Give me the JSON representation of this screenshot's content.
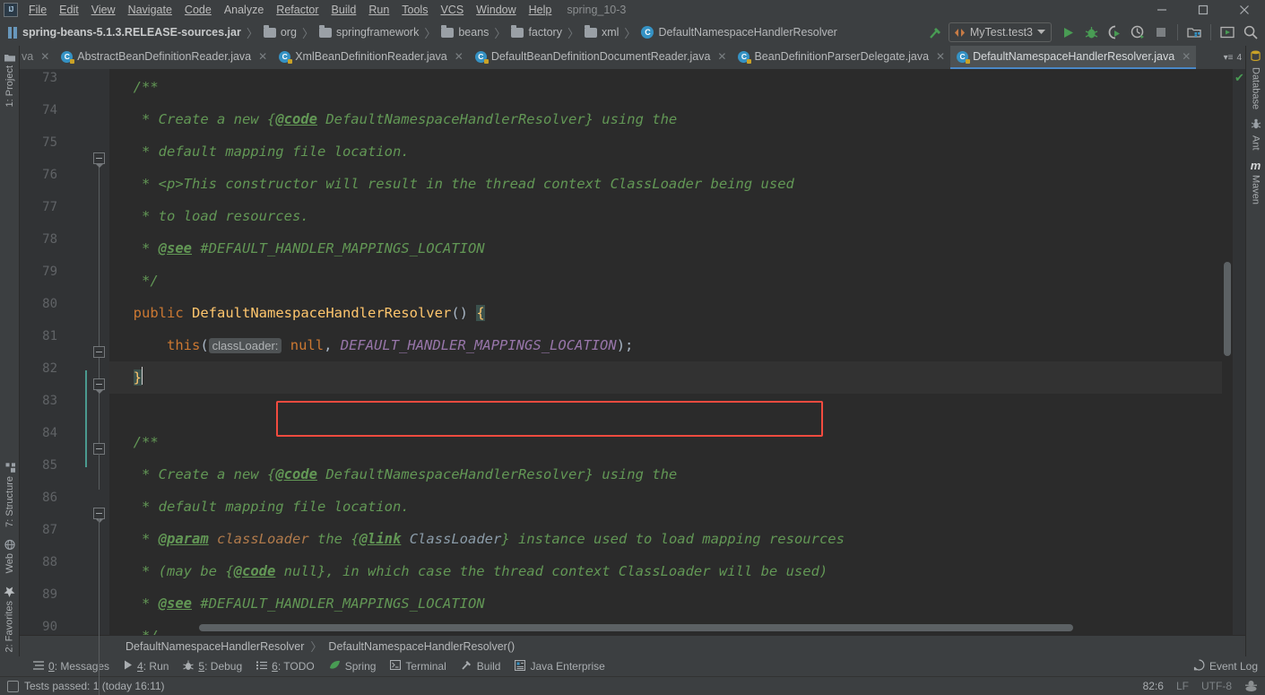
{
  "window": {
    "project_title": "spring_10-3",
    "minimize_label": "Minimize",
    "maximize_label": "Maximize",
    "close_label": "Close"
  },
  "menubar": {
    "logo": "IJ",
    "items": [
      {
        "label": "File"
      },
      {
        "label": "Edit"
      },
      {
        "label": "View"
      },
      {
        "label": "Navigate"
      },
      {
        "label": "Code"
      },
      {
        "label": "Analyze"
      },
      {
        "label": "Refactor"
      },
      {
        "label": "Build"
      },
      {
        "label": "Run"
      },
      {
        "label": "Tools"
      },
      {
        "label": "VCS"
      },
      {
        "label": "Window"
      },
      {
        "label": "Help"
      }
    ]
  },
  "navbar": {
    "crumbs": [
      {
        "label": "spring-beans-5.1.3.RELEASE-sources.jar",
        "icon": "jar-icon"
      },
      {
        "label": "org",
        "icon": "folder-icon"
      },
      {
        "label": "springframework",
        "icon": "folder-icon"
      },
      {
        "label": "beans",
        "icon": "folder-icon"
      },
      {
        "label": "factory",
        "icon": "folder-icon"
      },
      {
        "label": "xml",
        "icon": "folder-icon"
      },
      {
        "label": "DefaultNamespaceHandlerResolver",
        "icon": "class-icon"
      }
    ],
    "separator": "〉",
    "run_config": "MyTest.test3",
    "buttons": [
      {
        "name": "build-hammer-icon"
      },
      {
        "name": "run-icon"
      },
      {
        "name": "debug-icon"
      },
      {
        "name": "run-coverage-icon"
      },
      {
        "name": "profile-icon"
      },
      {
        "name": "stop-icon"
      },
      {
        "name": "project-structure-icon"
      },
      {
        "name": "update-app-icon"
      },
      {
        "name": "search-everywhere-icon"
      }
    ]
  },
  "tabs": {
    "ghost_label": "va",
    "items": [
      {
        "label": "AbstractBeanDefinitionReader.java",
        "active": false
      },
      {
        "label": "XmlBeanDefinitionReader.java",
        "active": false
      },
      {
        "label": "DefaultBeanDefinitionDocumentReader.java",
        "active": false
      },
      {
        "label": "BeanDefinitionParserDelegate.java",
        "active": false
      },
      {
        "label": "DefaultNamespaceHandlerResolver.java",
        "active": true
      }
    ],
    "overflow_count": "4"
  },
  "rails": {
    "left_top": [
      {
        "label": "1: Project",
        "icon": "project-folder-icon"
      }
    ],
    "left_bottom": [
      {
        "label": "7: Structure",
        "icon": "structure-icon"
      },
      {
        "label": "Web",
        "icon": "web-globe-icon"
      },
      {
        "label": "2: Favorites",
        "icon": "star-icon"
      }
    ],
    "right": [
      {
        "label": "Database",
        "icon": "database-icon"
      },
      {
        "label": "Ant",
        "icon": "ant-icon"
      },
      {
        "label": "Maven",
        "icon": "maven-icon"
      }
    ]
  },
  "editor": {
    "lines": [
      {
        "num": "73",
        "tokens": [
          {
            "t": "  /**",
            "c": "cmt"
          }
        ]
      },
      {
        "num": "74",
        "tokens": [
          {
            "t": "   * Create a new {",
            "c": "cmt"
          },
          {
            "t": "@code",
            "c": "tag"
          },
          {
            "t": " DefaultNamespaceHandlerResolver} using the",
            "c": "cmt"
          }
        ]
      },
      {
        "num": "75",
        "tokens": [
          {
            "t": "   * default mapping file location.",
            "c": "cmt"
          }
        ]
      },
      {
        "num": "76",
        "tokens": [
          {
            "t": "   * <p>This constructor will result in the thread context ClassLoader being used",
            "c": "cmt"
          }
        ]
      },
      {
        "num": "77",
        "tokens": [
          {
            "t": "   * to load resources.",
            "c": "cmt"
          }
        ]
      },
      {
        "num": "78",
        "tokens": [
          {
            "t": "   * ",
            "c": "cmt"
          },
          {
            "t": "@see",
            "c": "tag"
          },
          {
            "t": " #DEFAULT_HANDLER_MAPPINGS_LOCATION",
            "c": "cmt"
          }
        ]
      },
      {
        "num": "79",
        "tokens": [
          {
            "t": "   */",
            "c": "cmt"
          }
        ]
      },
      {
        "num": "80",
        "tokens": [
          {
            "t": "  ",
            "c": "pl"
          },
          {
            "t": "public",
            "c": "kw"
          },
          {
            "t": " ",
            "c": "pl"
          },
          {
            "t": "DefaultNamespaceHandlerResolver",
            "c": "cls"
          },
          {
            "t": "() ",
            "c": "pl"
          },
          {
            "t": "{",
            "c": "brkt-hl"
          }
        ]
      },
      {
        "num": "81",
        "tokens": [
          {
            "t": "      ",
            "c": "pl"
          },
          {
            "t": "this",
            "c": "kw"
          },
          {
            "t": "(",
            "c": "pl"
          },
          {
            "t": "classLoader:",
            "c": "hint"
          },
          {
            "t": " ",
            "c": "pl"
          },
          {
            "t": "null",
            "c": "kw"
          },
          {
            "t": ", ",
            "c": "pl"
          },
          {
            "t": "DEFAULT_HANDLER_MAPPINGS_LOCATION",
            "c": "fld"
          },
          {
            "t": ");",
            "c": "pl"
          }
        ]
      },
      {
        "num": "82",
        "tokens": [
          {
            "t": "  ",
            "c": "pl"
          },
          {
            "t": "}",
            "c": "brkt-hl"
          }
        ],
        "current": true
      },
      {
        "num": "83",
        "tokens": [
          {
            "t": "",
            "c": "pl"
          }
        ]
      },
      {
        "num": "84",
        "tokens": [
          {
            "t": "  /**",
            "c": "cmt"
          }
        ]
      },
      {
        "num": "85",
        "tokens": [
          {
            "t": "   * Create a new {",
            "c": "cmt"
          },
          {
            "t": "@code",
            "c": "tag"
          },
          {
            "t": " DefaultNamespaceHandlerResolver} using the",
            "c": "cmt"
          }
        ]
      },
      {
        "num": "86",
        "tokens": [
          {
            "t": "   * default mapping file location.",
            "c": "cmt"
          }
        ]
      },
      {
        "num": "87",
        "tokens": [
          {
            "t": "   * ",
            "c": "cmt"
          },
          {
            "t": "@param",
            "c": "tag"
          },
          {
            "t": " ",
            "c": "cmt"
          },
          {
            "t": "classLoader",
            "c": "pmname"
          },
          {
            "t": " the {",
            "c": "cmt"
          },
          {
            "t": "@link",
            "c": "tag"
          },
          {
            "t": " ",
            "c": "cmt"
          },
          {
            "t": "ClassLoader",
            "c": "lnk"
          },
          {
            "t": "} instance used to load mapping resources",
            "c": "cmt"
          }
        ]
      },
      {
        "num": "88",
        "tokens": [
          {
            "t": "   * (may be {",
            "c": "cmt"
          },
          {
            "t": "@code",
            "c": "tag"
          },
          {
            "t": " null}, in which case the thread context ClassLoader will be used)",
            "c": "cmt"
          }
        ]
      },
      {
        "num": "89",
        "tokens": [
          {
            "t": "   * ",
            "c": "cmt"
          },
          {
            "t": "@see",
            "c": "tag"
          },
          {
            "t": " #DEFAULT_HANDLER_MAPPINGS_LOCATION",
            "c": "cmt"
          }
        ]
      },
      {
        "num": "90",
        "tokens": [
          {
            "t": "   */",
            "c": "cmt"
          }
        ]
      }
    ],
    "highlight_box_line": "81",
    "highlight_box_color": "#f24b3f",
    "inspection_status": "ok"
  },
  "breadcrumb_status": {
    "class": "DefaultNamespaceHandlerResolver",
    "member": "DefaultNamespaceHandlerResolver()",
    "separator": "〉"
  },
  "bottom_toolwindows": [
    {
      "key": "0",
      "label": ": Messages",
      "icon": "messages-icon"
    },
    {
      "key": "4",
      "label": ": Run",
      "icon": "run-icon"
    },
    {
      "key": "5",
      "label": ": Debug",
      "icon": "debug-icon"
    },
    {
      "key": "6",
      "label": ": TODO",
      "icon": "todo-icon"
    },
    {
      "key": "",
      "label": "Spring",
      "icon": "spring-leaf-icon"
    },
    {
      "key": "",
      "label": "Terminal",
      "icon": "terminal-icon"
    },
    {
      "key": "",
      "label": "Build",
      "icon": "build-hammer-icon"
    },
    {
      "key": "",
      "label": "Java Enterprise",
      "icon": "java-enterprise-icon"
    }
  ],
  "event_log": {
    "label": "Event Log",
    "icon": "event-log-icon"
  },
  "statusbar": {
    "message": "Tests passed: 1 (today 16:11)",
    "caret_position": "82:6",
    "line_separator": "LF",
    "encoding": "UTF-8",
    "lock_icon": "read-only-toggle-icon"
  },
  "colors": {
    "accent_blue": "#4a88c7",
    "chrome": "#3c3f41",
    "editor_bg": "#2b2b2b",
    "gutter_bg": "#313335",
    "comment_green": "#629755",
    "keyword_orange": "#cc7832",
    "class_yellow": "#ffc66d",
    "field_purple": "#9876aa",
    "highlight_red": "#f24b3f"
  }
}
